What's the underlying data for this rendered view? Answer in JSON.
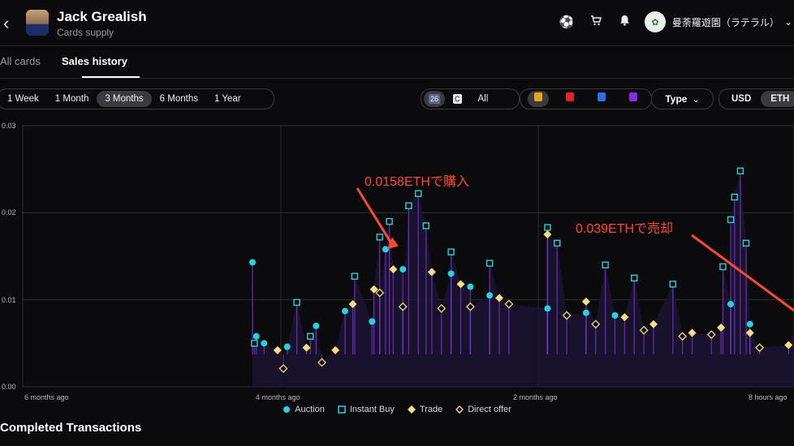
{
  "header": {
    "back_icon": "chevron-left-icon",
    "player_name": "Jack Grealish",
    "subtitle": "Cards supply",
    "icons": [
      "ball-icon",
      "cart-icon",
      "bell-icon"
    ],
    "user_name": "曼荼羅遊園（ラテラル）"
  },
  "tabs": [
    {
      "label": "All cards",
      "active": false
    },
    {
      "label": "Sales history",
      "active": true
    }
  ],
  "periods": [
    {
      "label": "1 Week",
      "active": false
    },
    {
      "label": "1 Month",
      "active": false
    },
    {
      "label": "3 Months",
      "active": true
    },
    {
      "label": "6 Months",
      "active": false
    },
    {
      "label": "1 Year",
      "active": false
    }
  ],
  "season_filter": [
    {
      "label": "26",
      "active": true
    },
    {
      "label": "C",
      "active": false
    },
    {
      "label": "All",
      "active": false
    }
  ],
  "rarity_colors": [
    "#e0a41e",
    "#e0242a",
    "#2f6fe6",
    "#8a2be2"
  ],
  "type_label": "Type",
  "currency": [
    {
      "label": "USD",
      "active": false
    },
    {
      "label": "ETH",
      "active": true
    }
  ],
  "annotations": {
    "buy": "0.0158ETHで購入",
    "sell": "0.039ETHで売却"
  },
  "bottom_title": "Completed Transactions",
  "colors": {
    "auction": "#22d3e0",
    "instant": "#22d3e0",
    "trade": "#f7e07a",
    "offer": "#e8cf7a",
    "line": "#8a3cf0",
    "arrow": "#ff4a30"
  },
  "chart_data": {
    "type": "scatter",
    "ylim": [
      0,
      0.03
    ],
    "yticks": [
      "0.03",
      "0.02",
      "0.01",
      "0.00"
    ],
    "xticks": [
      "6 months ago",
      "4 months ago",
      "2 months ago",
      "8 hours ago"
    ],
    "legend": [
      "Auction",
      "Instant Buy",
      "Trade",
      "Direct offer"
    ],
    "series": [
      {
        "name": "Auction",
        "points": [
          [
            0.2,
            0.0143
          ],
          [
            0.4,
            0.0058
          ],
          [
            0.8,
            0.005
          ],
          [
            2.0,
            0.0046
          ],
          [
            3.5,
            0.007
          ],
          [
            5.0,
            0.0087
          ],
          [
            6.4,
            0.0075
          ],
          [
            7.1,
            0.0158
          ],
          [
            8.0,
            0.0135
          ],
          [
            10.5,
            0.013
          ],
          [
            11.5,
            0.0115
          ],
          [
            12.5,
            0.0105
          ],
          [
            15.5,
            0.009
          ],
          [
            17.5,
            0.0085
          ],
          [
            19.0,
            0.0082
          ],
          [
            25.0,
            0.0095
          ],
          [
            26.0,
            0.0072
          ],
          [
            28.5,
            0.0075
          ],
          [
            30.5,
            0.0062
          ],
          [
            31.0,
            0.0041
          ]
        ]
      },
      {
        "name": "Instant Buy",
        "points": [
          [
            0.3,
            0.005
          ],
          [
            2.5,
            0.0097
          ],
          [
            3.2,
            0.0058
          ],
          [
            5.5,
            0.0127
          ],
          [
            6.8,
            0.0172
          ],
          [
            7.3,
            0.019
          ],
          [
            8.3,
            0.0208
          ],
          [
            8.8,
            0.0222
          ],
          [
            9.2,
            0.0185
          ],
          [
            10.5,
            0.0155
          ],
          [
            12.5,
            0.0142
          ],
          [
            15.5,
            0.0183
          ],
          [
            16.0,
            0.0165
          ],
          [
            18.5,
            0.014
          ],
          [
            20.0,
            0.0125
          ],
          [
            22.0,
            0.0118
          ],
          [
            25.5,
            0.0248
          ],
          [
            25.2,
            0.0218
          ],
          [
            25.0,
            0.0192
          ],
          [
            25.8,
            0.0165
          ],
          [
            24.6,
            0.0138
          ],
          [
            28.5,
            0.0128
          ],
          [
            29.5,
            0.0115
          ],
          [
            30.5,
            0.0125
          ],
          [
            31.5,
            0.0128
          ]
        ]
      },
      {
        "name": "Trade",
        "points": [
          [
            1.5,
            0.0042
          ],
          [
            3.0,
            0.0045
          ],
          [
            4.5,
            0.0042
          ],
          [
            5.4,
            0.0095
          ],
          [
            6.5,
            0.0112
          ],
          [
            7.5,
            0.0135
          ],
          [
            9.5,
            0.0132
          ],
          [
            11.0,
            0.0118
          ],
          [
            13.0,
            0.0102
          ],
          [
            15.5,
            0.0175
          ],
          [
            17.5,
            0.0098
          ],
          [
            19.5,
            0.008
          ],
          [
            21.0,
            0.0072
          ],
          [
            23.0,
            0.0062
          ],
          [
            24.5,
            0.0068
          ],
          [
            26.0,
            0.0062
          ],
          [
            28.0,
            0.0048
          ],
          [
            30.0,
            0.0052
          ],
          [
            31.5,
            0.0045
          ]
        ]
      },
      {
        "name": "Direct offer",
        "points": [
          [
            1.8,
            0.0021
          ],
          [
            3.8,
            0.0028
          ],
          [
            6.8,
            0.0108
          ],
          [
            8.0,
            0.0092
          ],
          [
            10.0,
            0.009
          ],
          [
            11.5,
            0.0092
          ],
          [
            13.5,
            0.0095
          ],
          [
            16.5,
            0.0082
          ],
          [
            18.0,
            0.0072
          ],
          [
            20.5,
            0.0065
          ],
          [
            22.5,
            0.0058
          ],
          [
            24.0,
            0.006
          ],
          [
            26.5,
            0.0045
          ],
          [
            29.0,
            0.0036
          ],
          [
            31.0,
            0.0038
          ]
        ]
      }
    ]
  }
}
